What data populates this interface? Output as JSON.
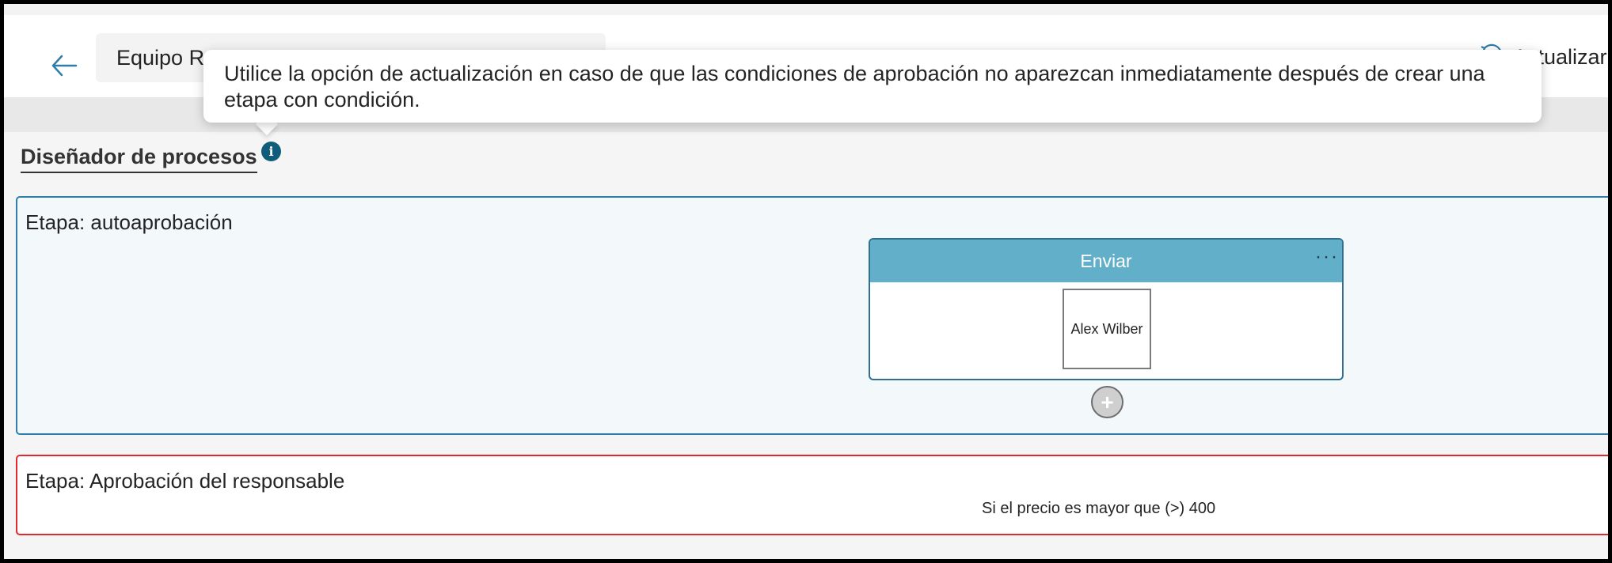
{
  "header": {
    "name_value": "Equipo R",
    "refresh_label": "Actualizar"
  },
  "tooltip": {
    "text": "Utilice la opción de actualización en caso de que las condiciones de aprobación no aparezcan inmediatamente después de crear una etapa con condición."
  },
  "designer": {
    "title": "Diseñador de procesos",
    "info_icon_glyph": "i"
  },
  "stages": [
    {
      "title": "Etapa: autoaprobación",
      "step": {
        "title": "Enviar",
        "more_glyph": "···",
        "approver": "Alex Wilber"
      },
      "add_glyph": "+"
    },
    {
      "title": "Etapa: Aprobación del responsable",
      "condition": "Si el precio es mayor que (>) 400"
    }
  ],
  "colors": {
    "accent": "#2f7da8",
    "card_header": "#62afca",
    "stage_error_border": "#e0282e",
    "info_icon": "#0f5d7a"
  },
  "icons": {
    "back": "back-arrow-icon",
    "refresh": "refresh-icon",
    "info": "info-icon",
    "more": "more-icon",
    "add": "add-icon"
  }
}
